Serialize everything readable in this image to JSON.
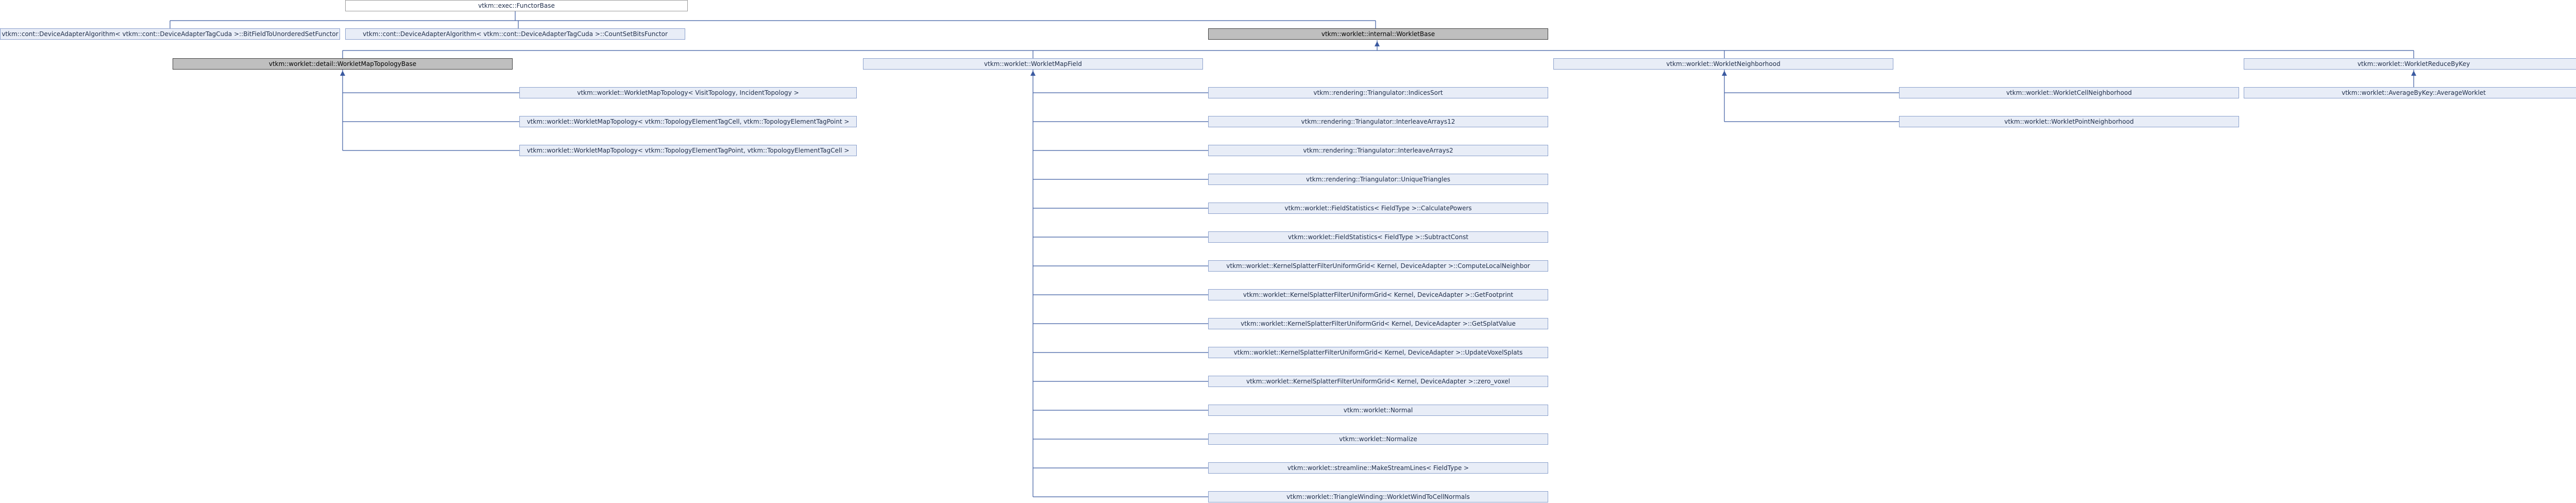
{
  "nodes": {
    "functorbase": "vtkm::exec::FunctorBase",
    "bitfield": "vtkm::cont::DeviceAdapterAlgorithm< vtkm::cont::DeviceAdapterTagCuda >::BitFieldToUnorderedSetFunctor",
    "countsetbits": "vtkm::cont::DeviceAdapterAlgorithm< vtkm::cont::DeviceAdapterTagCuda >::CountSetBitsFunctor",
    "workletbase": "vtkm::worklet::internal::WorkletBase",
    "wmtopobase": "vtkm::worklet::detail::WorkletMapTopologyBase",
    "wmfield": "vtkm::worklet::WorkletMapField",
    "wneighborhood": "vtkm::worklet::WorkletNeighborhood",
    "wreducebykey": "vtkm::worklet::WorkletReduceByKey",
    "wmt_vis": "vtkm::worklet::WorkletMapTopology< VisitTopology, IncidentTopology >",
    "wmt_cellpoint": "vtkm::worklet::WorkletMapTopology< vtkm::TopologyElementTagCell, vtkm::TopologyElementTagPoint >",
    "wmt_pointcell": "vtkm::worklet::WorkletMapTopology< vtkm::TopologyElementTagPoint, vtkm::TopologyElementTagCell >",
    "tri_indices": "vtkm::rendering::Triangulator::IndicesSort",
    "tri_interleave12": "vtkm::rendering::Triangulator::InterleaveArrays12",
    "tri_interleave2": "vtkm::rendering::Triangulator::InterleaveArrays2",
    "tri_unique": "vtkm::rendering::Triangulator::UniqueTriangles",
    "fs_powers": "vtkm::worklet::FieldStatistics< FieldType >::CalculatePowers",
    "fs_subtract": "vtkm::worklet::FieldStatistics< FieldType >::SubtractConst",
    "ks_compute": "vtkm::worklet::KernelSplatterFilterUniformGrid< Kernel, DeviceAdapter >::ComputeLocalNeighbor",
    "ks_footprint": "vtkm::worklet::KernelSplatterFilterUniformGrid< Kernel, DeviceAdapter >::GetFootprint",
    "ks_splat": "vtkm::worklet::KernelSplatterFilterUniformGrid< Kernel, DeviceAdapter >::GetSplatValue",
    "ks_update": "vtkm::worklet::KernelSplatterFilterUniformGrid< Kernel, DeviceAdapter >::UpdateVoxelSplats",
    "ks_zero": "vtkm::worklet::KernelSplatterFilterUniformGrid< Kernel, DeviceAdapter >::zero_voxel",
    "normal": "vtkm::worklet::Normal",
    "normalize": "vtkm::worklet::Normalize",
    "streamline": "vtkm::worklet::streamline::MakeStreamLines< FieldType >",
    "triwinding": "vtkm::worklet::TriangleWinding::WorkletWindToCellNormals",
    "wcellneighborhood": "vtkm::worklet::WorkletCellNeighborhood",
    "wpointneighborhood": "vtkm::worklet::WorkletPointNeighborhood",
    "averagebykey": "vtkm::worklet::AverageByKey::AverageWorklet"
  },
  "colors": {
    "node_fill": "#e8edf7",
    "node_border": "#8aa0cc",
    "current_fill": "#bfbfbf",
    "edge": "#3b5aa0"
  }
}
